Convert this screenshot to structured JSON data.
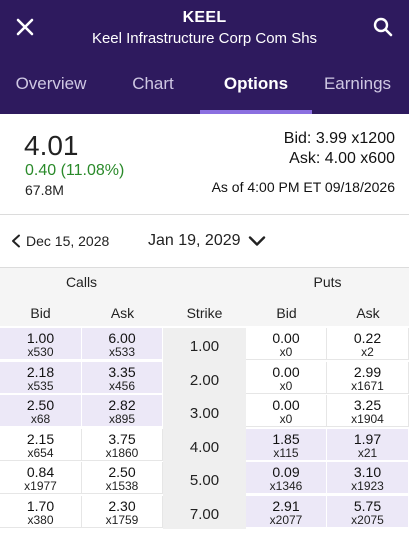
{
  "header": {
    "ticker": "KEEL",
    "company": "Keel Infrastructure Corp Com Shs",
    "tabs": [
      "Overview",
      "Chart",
      "Options",
      "Earnings"
    ],
    "active_tab": "Options"
  },
  "quote": {
    "last": "4.01",
    "change": "0.40 (11.08%)",
    "volume": "67.8M",
    "bid": "Bid: 3.99 x1200",
    "ask": "Ask: 4.00 x600",
    "as_of": "As of 4:00 PM ET 09/18/2026"
  },
  "expiry": {
    "previous": "Dec 15, 2028",
    "current": "Jan 19, 2029"
  },
  "chain": {
    "calls_label": "Calls",
    "puts_label": "Puts",
    "columns": {
      "call_bid": "Bid",
      "call_ask": "Ask",
      "strike": "Strike",
      "put_bid": "Bid",
      "put_ask": "Ask"
    },
    "rows": [
      {
        "strike": "1.00",
        "call_bid": "1.00",
        "call_bid_size": "x530",
        "call_ask": "6.00",
        "call_ask_size": "x533",
        "put_bid": "0.00",
        "put_bid_size": "x0",
        "put_ask": "0.22",
        "put_ask_size": "x2"
      },
      {
        "strike": "2.00",
        "call_bid": "2.18",
        "call_bid_size": "x535",
        "call_ask": "3.35",
        "call_ask_size": "x456",
        "put_bid": "0.00",
        "put_bid_size": "x0",
        "put_ask": "2.99",
        "put_ask_size": "x1671"
      },
      {
        "strike": "3.00",
        "call_bid": "2.50",
        "call_bid_size": "x68",
        "call_ask": "2.82",
        "call_ask_size": "x895",
        "put_bid": "0.00",
        "put_bid_size": "x0",
        "put_ask": "3.25",
        "put_ask_size": "x1904"
      },
      {
        "strike": "4.00",
        "call_bid": "2.15",
        "call_bid_size": "x654",
        "call_ask": "3.75",
        "call_ask_size": "x1860",
        "put_bid": "1.85",
        "put_bid_size": "x115",
        "put_ask": "1.97",
        "put_ask_size": "x21"
      },
      {
        "strike": "5.00",
        "call_bid": "0.84",
        "call_bid_size": "x1977",
        "call_ask": "2.50",
        "call_ask_size": "x1538",
        "put_bid": "0.09",
        "put_bid_size": "x1346",
        "put_ask": "3.10",
        "put_ask_size": "x1923"
      },
      {
        "strike": "7.00",
        "call_bid": "1.70",
        "call_bid_size": "x380",
        "call_ask": "2.30",
        "call_ask_size": "x1759",
        "put_bid": "2.91",
        "put_bid_size": "x2077",
        "put_ask": "5.75",
        "put_ask_size": "x2075"
      }
    ],
    "in_the_money_calls": [
      "1.00",
      "2.00",
      "3.00"
    ],
    "in_the_money_puts": [
      "4.00",
      "5.00",
      "7.00"
    ]
  },
  "icons": {
    "close": "close-icon",
    "search": "search-icon",
    "prev": "chevron-left-icon",
    "dropdown": "chevron-down-icon"
  },
  "colors": {
    "header_bg": "#2e1a5e",
    "tab_indicator": "#8b6fe0",
    "positive_change": "#2a8a2a",
    "in_the_money": "#ece8f7"
  }
}
